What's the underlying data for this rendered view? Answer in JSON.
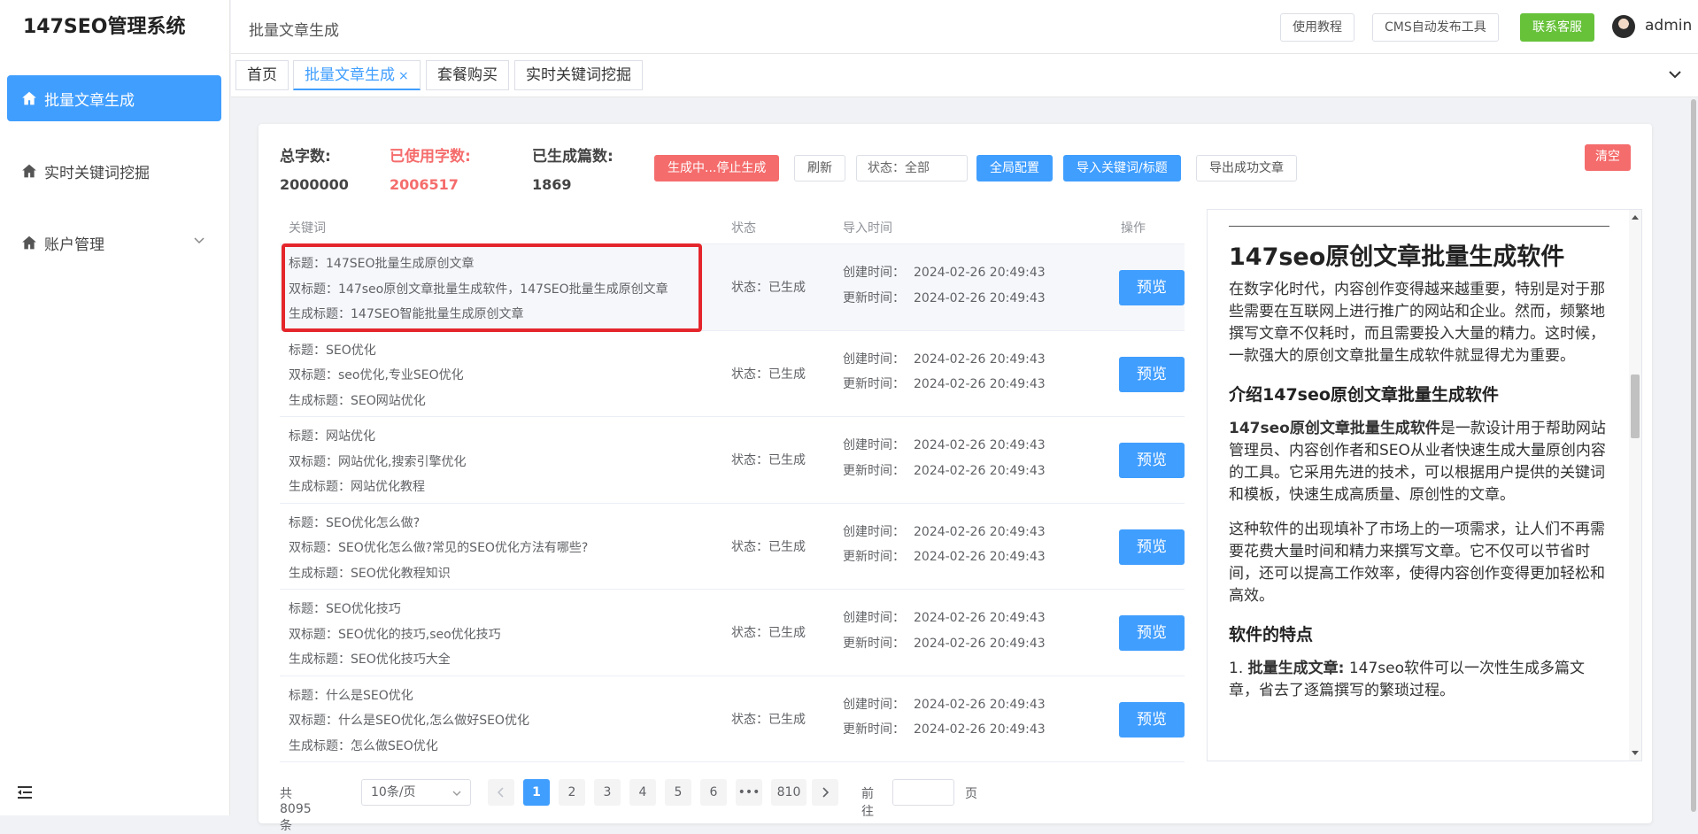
{
  "app": {
    "title": "147SEO管理系统"
  },
  "sidebar": {
    "items": [
      {
        "label": "批量文章生成",
        "icon": "home-icon"
      },
      {
        "label": "实时关键词挖掘",
        "icon": "home-icon"
      },
      {
        "label": "账户管理",
        "icon": "home-icon"
      }
    ]
  },
  "header": {
    "breadcrumb": "批量文章生成",
    "buttons": {
      "tutorial": "使用教程",
      "cms": "CMS自动发布工具",
      "support": "联系客服"
    },
    "user": "admin"
  },
  "tabs": [
    "首页",
    "批量文章生成",
    "套餐购买",
    "实时关键词挖掘"
  ],
  "tab_close": "×",
  "stats": {
    "total_label": "总字数:",
    "total_value": "2000000",
    "used_label": "已使用字数:",
    "used_value": "2006517",
    "generated_label": "已生成篇数:",
    "generated_value": "1869"
  },
  "toolbar": {
    "stop": "生成中...停止生成",
    "refresh": "刷新",
    "status_select": "状态：全部",
    "global_config": "全局配置",
    "import": "导入关键词/标题",
    "export": "导出成功文章",
    "clear": "清空"
  },
  "table": {
    "headers": {
      "keyword": "关键词",
      "status": "状态",
      "import_time": "导入时间",
      "action": "操作"
    },
    "rows": [
      {
        "title": "标题：147SEO批量生成原创文章",
        "double": "双标题：147seo原创文章批量生成软件，147SEO批量生成原创文章",
        "gen": "生成标题：147SEO智能批量生成原创文章",
        "status": "状态：已生成",
        "created": "2024-02-26 20:49:43",
        "updated": "2024-02-26 20:49:43",
        "action": "预览"
      },
      {
        "title": "标题：SEO优化",
        "double": "双标题：seo优化,专业SEO优化",
        "gen": "生成标题：SEO网站优化",
        "status": "状态：已生成",
        "created": "2024-02-26 20:49:43",
        "updated": "2024-02-26 20:49:43",
        "action": "预览"
      },
      {
        "title": "标题：网站优化",
        "double": "双标题：网站优化,搜索引擎优化",
        "gen": "生成标题：网站优化教程",
        "status": "状态：已生成",
        "created": "2024-02-26 20:49:43",
        "updated": "2024-02-26 20:49:43",
        "action": "预览"
      },
      {
        "title": "标题：SEO优化怎么做?",
        "double": "双标题：SEO优化怎么做?常见的SEO优化方法有哪些?",
        "gen": "生成标题：SEO优化教程知识",
        "status": "状态：已生成",
        "created": "2024-02-26 20:49:43",
        "updated": "2024-02-26 20:49:43",
        "action": "预览"
      },
      {
        "title": "标题：SEO优化技巧",
        "double": "双标题：SEO优化的技巧,seo优化技巧",
        "gen": "生成标题：SEO优化技巧大全",
        "status": "状态：已生成",
        "created": "2024-02-26 20:49:43",
        "updated": "2024-02-26 20:49:43",
        "action": "预览"
      },
      {
        "title": "标题：什么是SEO优化",
        "double": "双标题：什么是SEO优化,怎么做好SEO优化",
        "gen": "生成标题：怎么做SEO优化",
        "status": "状态：已生成",
        "created": "2024-02-26 20:49:43",
        "updated": "2024-02-26 20:49:43",
        "action": "预览"
      }
    ],
    "created_label": "创建时间：",
    "updated_label": "更新时间："
  },
  "preview": {
    "h1": "147seo原创文章批量生成软件",
    "p1": "在数字化时代，内容创作变得越来越重要，特别是对于那些需要在互联网上进行推广的网站和企业。然而，频繁地撰写文章不仅耗时，而且需要投入大量的精力。这时候，一款强大的原创文章批量生成软件就显得尤为重要。",
    "h2a": "介绍147seo原创文章批量生成软件",
    "p2_bold": "147seo原创文章批量生成软件",
    "p2_rest": "是一款设计用于帮助网站管理员、内容创作者和SEO从业者快速生成大量原创内容的工具。它采用先进的技术，可以根据用户提供的关键词和模板，快速生成高质量、原创性的文章。",
    "p3": "这种软件的出现填补了市场上的一项需求，让人们不再需要花费大量时间和精力来撰写文章。它不仅可以节省时间，还可以提高工作效率，使得内容创作变得更加轻松和高效。",
    "h2b": "软件的特点",
    "li1_num": "1.",
    "li1_bold": "批量生成文章:",
    "li1_rest": "147seo软件可以一次性生成多篇文章，省去了逐篇撰写的繁琐过程。"
  },
  "pagination": {
    "total": "共 8095 条",
    "page_size": "10条/页",
    "pages": [
      "1",
      "2",
      "3",
      "4",
      "5",
      "6",
      "•••",
      "810"
    ],
    "current": "1",
    "goto_label": "前往",
    "page_unit": "页"
  },
  "colors": {
    "primary": "#409eff",
    "danger": "#f56c6c",
    "success": "#67c23a",
    "highlight": "#e4262c"
  }
}
